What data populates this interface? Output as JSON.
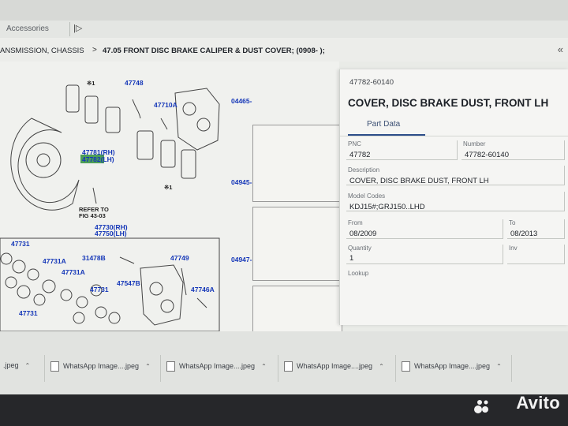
{
  "tabbar": {
    "tab_label": "Accessories",
    "tab_icon": "open-panel-icon"
  },
  "breadcrumb": {
    "left": "ANSMISSION, CHASSIS",
    "separator": ">",
    "title": "47.05 FRONT DISC BRAKE CALIPER & DUST COVER; (0908- );",
    "collapse_icon": "double-chevron-left-icon"
  },
  "diagram": {
    "labels": {
      "p47748": "47748",
      "p47710a": "47710A",
      "p47781": "47781(RH)",
      "p47782": "47782(LH)",
      "refer1": "REFER TO",
      "refer2": "FIG 43-03",
      "p47730": "47730(RH)",
      "p47750": "47750(LH)",
      "p47731_1": "47731",
      "p47731a_1": "47731A",
      "p31478b": "31478B",
      "p47749": "47749",
      "p47731a_2": "47731A",
      "p47547b": "47547B",
      "p47731_2": "47731",
      "p47746a": "47746A",
      "p47731_3": "47731",
      "star": "※1"
    },
    "thumb_labels": [
      "04465-",
      "04945-",
      "04947-"
    ]
  },
  "detail": {
    "part_no": "47782-60140",
    "title": "COVER, DISC BRAKE DUST, FRONT LH",
    "tab": "Part Data",
    "pnc_label": "PNC",
    "pnc": "47782",
    "number_label": "Number",
    "number": "47782-60140",
    "description_label": "Description",
    "description": "COVER, DISC BRAKE DUST, FRONT LH",
    "model_codes_label": "Model Codes",
    "model_codes": "KDJ15#;GRJ150..LHD",
    "from_label": "From",
    "from": "08/2009",
    "to_label": "To",
    "to": "08/2013",
    "quantity_label": "Quantity",
    "quantity": "1",
    "inv_label": "Inv",
    "lookup_label": "Lookup"
  },
  "downloads": {
    "first": ".jpeg",
    "items": [
      "WhatsApp Image....jpeg",
      "WhatsApp Image....jpeg",
      "WhatsApp Image....jpeg",
      "WhatsApp Image....jpeg"
    ]
  },
  "watermark": {
    "text": "Avito"
  },
  "colors": {
    "part_label_blue": "#1537b8",
    "highlight_green": "#2f8f3c",
    "tab_underline": "#2d4e8a"
  }
}
